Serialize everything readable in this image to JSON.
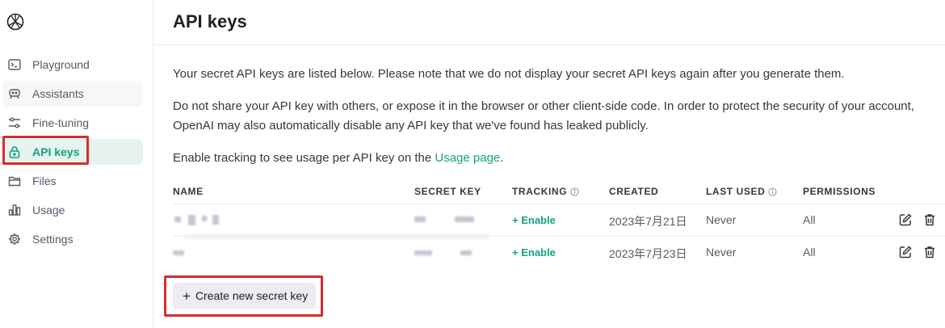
{
  "sidebar": {
    "logo_icon": "openai-logo-icon",
    "items": [
      {
        "label": "Playground",
        "icon": "terminal-icon"
      },
      {
        "label": "Assistants",
        "icon": "robot-icon"
      },
      {
        "label": "Fine-tuning",
        "icon": "sliders-icon"
      },
      {
        "label": "API keys",
        "icon": "lock-icon"
      },
      {
        "label": "Files",
        "icon": "folder-icon"
      },
      {
        "label": "Usage",
        "icon": "bar-chart-icon"
      },
      {
        "label": "Settings",
        "icon": "gear-icon"
      }
    ],
    "active_item": "API keys",
    "accent_color": "#10a37f"
  },
  "header": {
    "title": "API keys"
  },
  "intro": {
    "p1": "Your secret API keys are listed below. Please note that we do not display your secret API keys again after you generate them.",
    "p2": "Do not share your API key with others, or expose it in the browser or other client-side code. In order to protect the security of your account, OpenAI may also automatically disable any API key that we've found has leaked publicly.",
    "p3_prefix": "Enable tracking to see usage per API key on the ",
    "p3_link": "Usage page",
    "p3_suffix": "."
  },
  "table": {
    "columns": {
      "name": "NAME",
      "secret_key": "SECRET KEY",
      "tracking": "TRACKING",
      "created": "CREATED",
      "last_used": "LAST USED",
      "permissions": "PERMISSIONS"
    },
    "rows": [
      {
        "tracking": "+ Enable",
        "created": "2023年7月21日",
        "last_used": "Never",
        "permissions": "All"
      },
      {
        "tracking": "+ Enable",
        "created": "2023年7月23日",
        "last_used": "Never",
        "permissions": "All"
      }
    ]
  },
  "create_button": {
    "label": "Create new secret key",
    "icon": "plus-icon"
  },
  "highlight_color": "#d32f2f"
}
